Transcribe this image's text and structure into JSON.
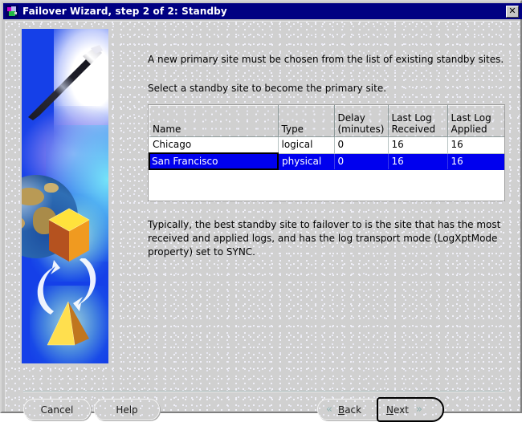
{
  "window": {
    "title": "Failover Wizard, step 2 of 2: Standby",
    "icon": "wizard-wand-icon",
    "close_label": "✕"
  },
  "banner": {
    "alt": "wizard banner with magic wand, globe, gold cube and pyramid exchanging roles"
  },
  "instructions": {
    "line1": "A new primary site must be chosen from the list of existing standby sites.",
    "line2": "Select a standby site to become the primary site."
  },
  "table": {
    "columns": [
      "Name",
      "Type",
      "Delay\n(minutes)",
      "Last Log\nReceived",
      "Last Log\nApplied"
    ],
    "columns_display": [
      {
        "line1": "",
        "line2": "Name"
      },
      {
        "line1": "",
        "line2": "Type"
      },
      {
        "line1": "Delay",
        "line2": "(minutes)"
      },
      {
        "line1": "Last Log",
        "line2": "Received"
      },
      {
        "line1": "Last Log",
        "line2": "Applied"
      }
    ],
    "rows": [
      {
        "name": "Chicago",
        "type": "logical",
        "delay": "0",
        "last_log_received": "16",
        "last_log_applied": "16",
        "selected": false
      },
      {
        "name": "San Francisco",
        "type": "physical",
        "delay": "0",
        "last_log_received": "16",
        "last_log_applied": "16",
        "selected": true
      }
    ],
    "selection_color": "#0000ee"
  },
  "note": "Typically, the best standby site to failover to is the site that has the most received and applied logs, and has the log transport mode (LogXptMode property) set to SYNC.",
  "buttons": {
    "cancel": "Cancel",
    "help": "Help",
    "back": {
      "mnemonic": "B",
      "rest": "ack",
      "chevron": "«"
    },
    "next": {
      "mnemonic": "N",
      "rest": "ext",
      "chevron": "»"
    }
  }
}
